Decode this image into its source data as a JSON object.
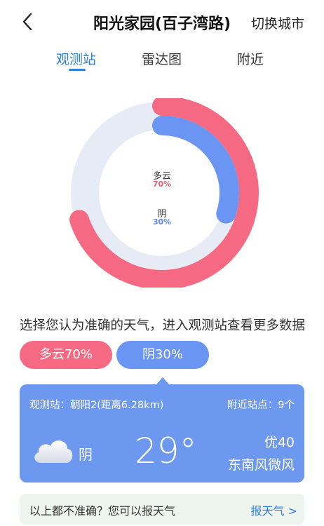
{
  "header": {
    "title": "阳光家园(百子湾路)",
    "switch_city": "切换城市",
    "back_icon": "chevron-left-icon"
  },
  "tabs": [
    {
      "label": "观测站",
      "active": true
    },
    {
      "label": "雷达图",
      "active": false
    },
    {
      "label": "附近",
      "active": false
    }
  ],
  "chart_data": {
    "type": "pie",
    "series": [
      {
        "name": "多云",
        "value": 70,
        "label": "70%",
        "color": "#f56a82"
      },
      {
        "name": "阴",
        "value": 30,
        "label": "30%",
        "color": "#6a95f2"
      }
    ],
    "track_color": "#e7ebf5"
  },
  "prompt": "选择您认为准确的天气，进入观测站查看更多数据",
  "choices": [
    {
      "label": "多云70%",
      "color": "#f56a82"
    },
    {
      "label": "阴30%",
      "color": "#6a95f2"
    }
  ],
  "card": {
    "station": "观测站：朝阳2(距离6.28km)",
    "nearby": "附近站点：9个",
    "weather_icon": "cloud-icon",
    "weather": "阴",
    "temperature": "29°",
    "aqi": "优40",
    "wind": "东南风微风",
    "background": "#6d98ef"
  },
  "footer": {
    "question": "以上都不准确？您可以报天气",
    "report_link": "报天气 >"
  }
}
